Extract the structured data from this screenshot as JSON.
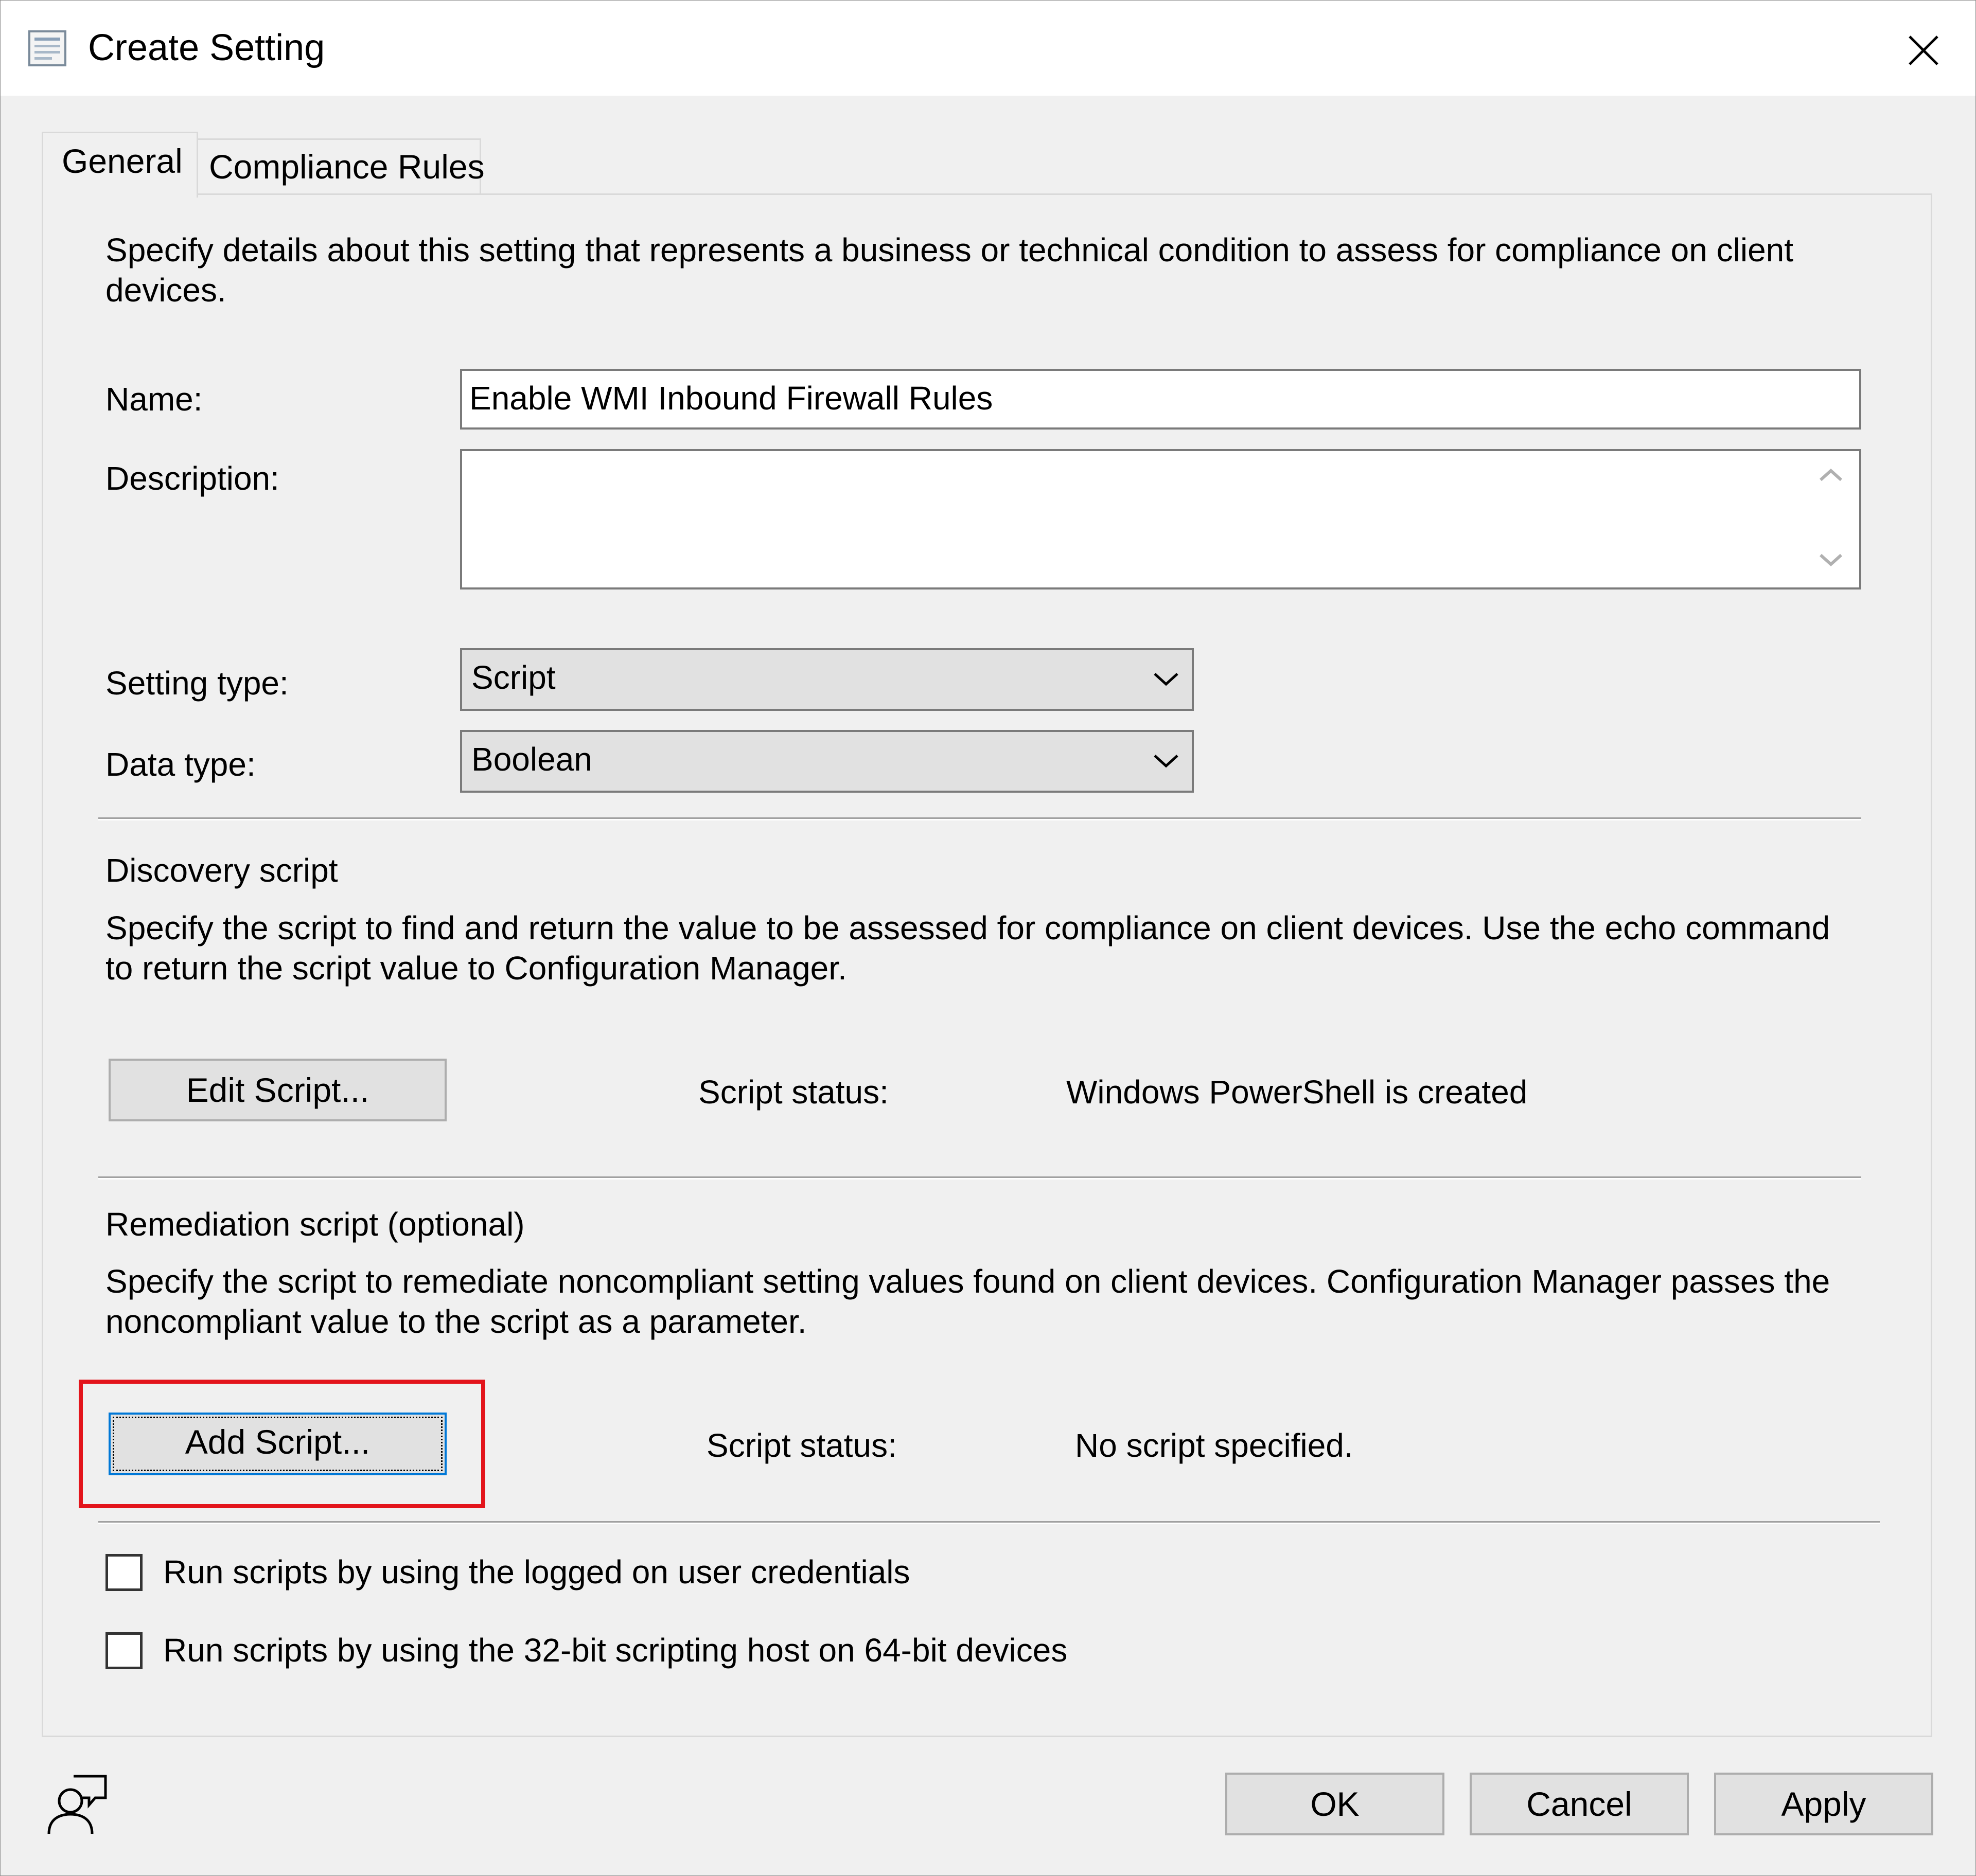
{
  "window": {
    "title": "Create Setting"
  },
  "tabs": [
    {
      "label": "General",
      "selected": true
    },
    {
      "label": "Compliance Rules",
      "selected": false
    }
  ],
  "general": {
    "intro": "Specify details about this setting that represents a business or technical condition to assess for compliance on client devices.",
    "name_label": "Name:",
    "name_value": "Enable WMI Inbound Firewall Rules",
    "description_label": "Description:",
    "description_value": "",
    "setting_type_label": "Setting type:",
    "setting_type_value": "Script",
    "data_type_label": "Data type:",
    "data_type_value": "Boolean"
  },
  "discovery": {
    "heading": "Discovery script",
    "description": "Specify the script to find and return the value to be assessed for compliance on client devices. Use the echo command to return the script value to Configuration Manager.",
    "button_label": "Edit Script...",
    "status_label": "Script status:",
    "status_value": "Windows PowerShell is created"
  },
  "remediation": {
    "heading": "Remediation script (optional)",
    "description": "Specify the script to remediate noncompliant setting values found on client devices. Configuration Manager passes the noncompliant value to the script as a parameter.",
    "button_label": "Add Script...",
    "status_label": "Script status:",
    "status_value": "No script specified."
  },
  "options": [
    {
      "label": "Run scripts by using the logged on user credentials",
      "checked": false
    },
    {
      "label": "Run scripts by using the 32-bit scripting host on 64-bit devices",
      "checked": false
    }
  ],
  "footer": {
    "ok_label": "OK",
    "cancel_label": "Cancel",
    "apply_label": "Apply",
    "help_icon": "user-help-icon"
  },
  "colors": {
    "highlight": "#e3141b",
    "focus": "#0078d7"
  }
}
